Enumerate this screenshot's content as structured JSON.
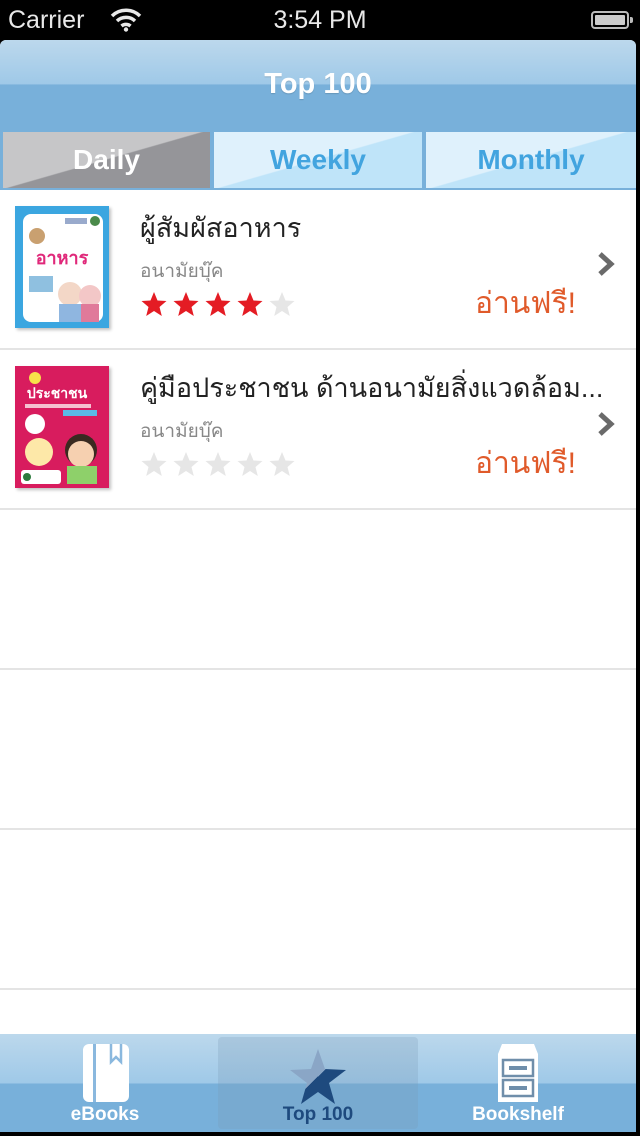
{
  "status_bar": {
    "carrier": "Carrier",
    "time": "3:54 PM",
    "wifi_icon": "wifi-icon",
    "battery_icon": "battery-icon"
  },
  "nav_bar": {
    "title": "Top 100"
  },
  "segments": {
    "selected": "Daily",
    "items": [
      {
        "label": "Daily"
      },
      {
        "label": "Weekly"
      },
      {
        "label": "Monthly"
      }
    ]
  },
  "books": [
    {
      "title": "ผู้สัมผัสอาหาร",
      "author": "อนามัยบุ๊ค",
      "rating": 4,
      "max_rating": 5,
      "action": "อ่านฟรี!",
      "cover_text": "อาหาร",
      "cover_color": "#3ba6e0"
    },
    {
      "title": "คู่มือประชาชน ด้านอนามัยสิ่งแวดล้อม...",
      "author": "อนามัยบุ๊ค",
      "rating": 0,
      "max_rating": 5,
      "action": "อ่านฟรี!",
      "cover_text": "ประชาชน",
      "cover_color": "#d81c5e"
    }
  ],
  "colors": {
    "star_filled": "#e41c24",
    "star_empty": "#e6e6e6",
    "action": "#e05a2a",
    "accent": "#42a4df"
  },
  "tab_bar": {
    "selected": "Top 100",
    "items": [
      {
        "label": "eBooks",
        "icon": "book-icon"
      },
      {
        "label": "Top 100",
        "icon": "star-icon"
      },
      {
        "label": "Bookshelf",
        "icon": "cabinet-icon"
      }
    ]
  }
}
